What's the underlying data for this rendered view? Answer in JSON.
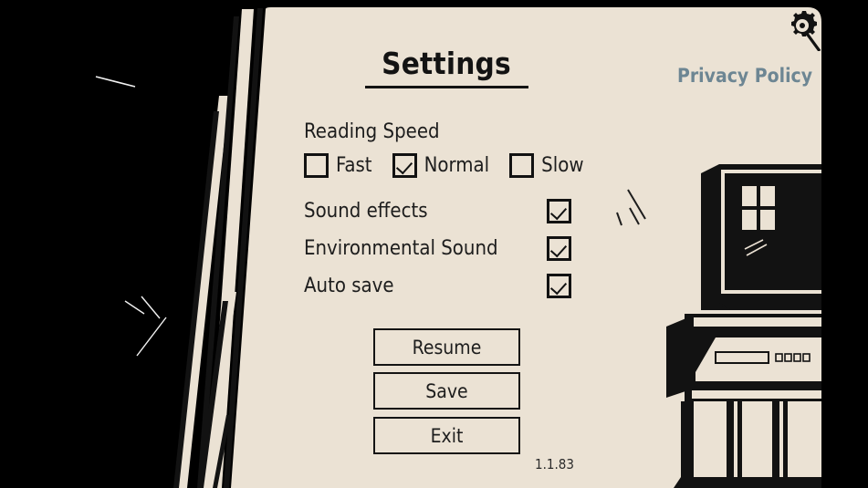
{
  "screen": {
    "title": "Settings",
    "version": "1.1.83",
    "background_color": "#000000",
    "panel_color": "#EBE2D4",
    "ink_color": "#131313",
    "accent_color": "#6d8693"
  },
  "header": {
    "title": "Settings",
    "privacy_policy_label": "Privacy Policy",
    "gear_icon": "gear-icon"
  },
  "settings": {
    "reading_speed": {
      "label": "Reading Speed",
      "options": [
        {
          "label": "Fast",
          "checked": false
        },
        {
          "label": "Normal",
          "checked": true
        },
        {
          "label": "Slow",
          "checked": false
        }
      ]
    },
    "toggles": [
      {
        "label": "Sound effects",
        "checked": true
      },
      {
        "label": "Environmental Sound",
        "checked": true
      },
      {
        "label": "Auto save",
        "checked": true
      }
    ]
  },
  "menu": {
    "buttons": [
      {
        "label": "Resume"
      },
      {
        "label": "Save"
      },
      {
        "label": "Exit"
      }
    ]
  },
  "artwork": {
    "description": "hand-drawn torn-paper panel with CRT television on a VCR stand",
    "icons": [
      "crt-television-icon",
      "vcr-player-icon",
      "scratch-marks"
    ]
  }
}
